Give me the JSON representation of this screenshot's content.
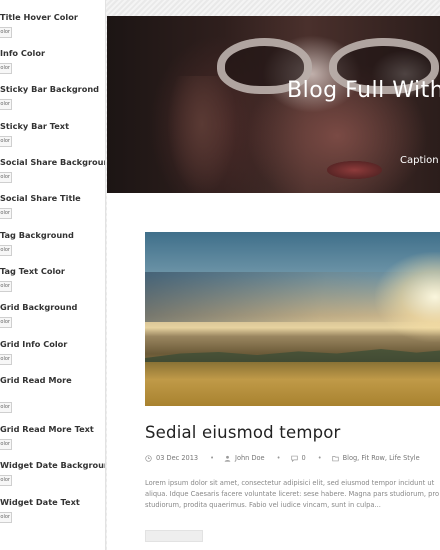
{
  "customizer": {
    "options": [
      {
        "label": "Title Hover Color",
        "button": "olor"
      },
      {
        "label": "Info Color",
        "button": "olor"
      },
      {
        "label": "Sticky Bar Backgrond",
        "button": "olor"
      },
      {
        "label": "Sticky Bar Text",
        "button": "olor"
      },
      {
        "label": "Social Share Background",
        "button": "olor"
      },
      {
        "label": "Social Share Title",
        "button": "olor"
      },
      {
        "label": "Tag Background",
        "button": "olor"
      },
      {
        "label": "Tag Text Color",
        "button": "olor"
      },
      {
        "label": "Grid Background",
        "button": "olor"
      },
      {
        "label": "Grid Info Color",
        "button": "olor"
      },
      {
        "label": "Grid Read More",
        "button": "olor"
      },
      {
        "label": "Grid Read More Text",
        "button": "olor"
      },
      {
        "label": "Widget Date Background",
        "button": "olor"
      },
      {
        "label": "Widget Date Text",
        "button": "olor"
      }
    ]
  },
  "hero": {
    "title": "Blog Full With",
    "caption": "Caption p"
  },
  "post": {
    "title": "Sedial eiusmod tempor",
    "date": "03 Dec 2013",
    "author": "John Doe",
    "comments": "0",
    "categories": "Blog, Fit Row, Life Style",
    "excerpt": [
      "Lorem ipsum dolor sit amet, consectetur adipisici elit, sed eiusmod tempor incidunt ut",
      "aliqua. Idque Caesaris facere voluntate liceret: sese habere. Magna pars studiorum, pro",
      "studiorum, prodita quaerimus. Fabio vel iudice vincam, sunt in culpa..."
    ]
  },
  "colors": {
    "panel_bg": "#ffffff",
    "title_text": "#222222",
    "meta_text": "#777777"
  }
}
